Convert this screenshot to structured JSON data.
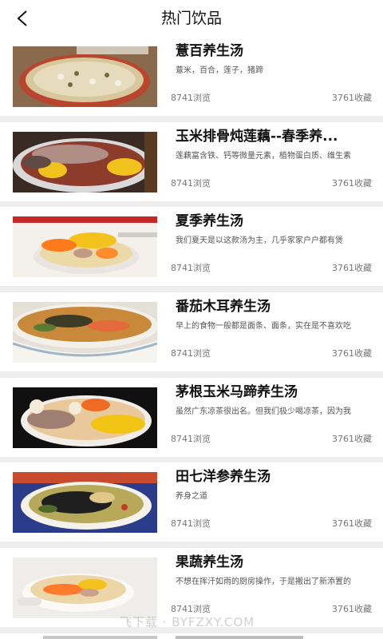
{
  "header": {
    "back_icon": "chevron-left-icon",
    "title": "热门饮品"
  },
  "items": [
    {
      "title": "薏百养生汤",
      "desc": "薏米，百合，莲子，猪蹄",
      "views": "8741浏览",
      "favs": "3761收藏"
    },
    {
      "title": "玉米排骨炖莲藕--春季养...",
      "desc": "莲藕富含铁、钙等微量元素，植物蛋白质、维生素",
      "views": "8741浏览",
      "favs": "3761收藏"
    },
    {
      "title": "夏季养生汤",
      "desc": "我们夏天是以这款汤为主，几乎家家户户都有煲",
      "views": "8741浏览",
      "favs": "3761收藏"
    },
    {
      "title": "番茄木耳养生汤",
      "desc": "早上的食物一般都是面条、面条，实在是不喜欢吃",
      "views": "8741浏览",
      "favs": "3761收藏"
    },
    {
      "title": "茅根玉米马蹄养生汤",
      "desc": "虽然广东凉茶很出名。但我们极少喝凉茶，因为我",
      "views": "8741浏览",
      "favs": "3761收藏"
    },
    {
      "title": "田七洋参养生汤",
      "desc": "养身之道",
      "views": "8741浏览",
      "favs": "3761收藏"
    },
    {
      "title": "果蔬养生汤",
      "desc": "不想在挥汗如雨的厨房操作，于是搬出了新添置的",
      "views": "8741浏览",
      "favs": "3761收藏"
    }
  ],
  "watermark": "飞下载 · BYFZXY.COM"
}
